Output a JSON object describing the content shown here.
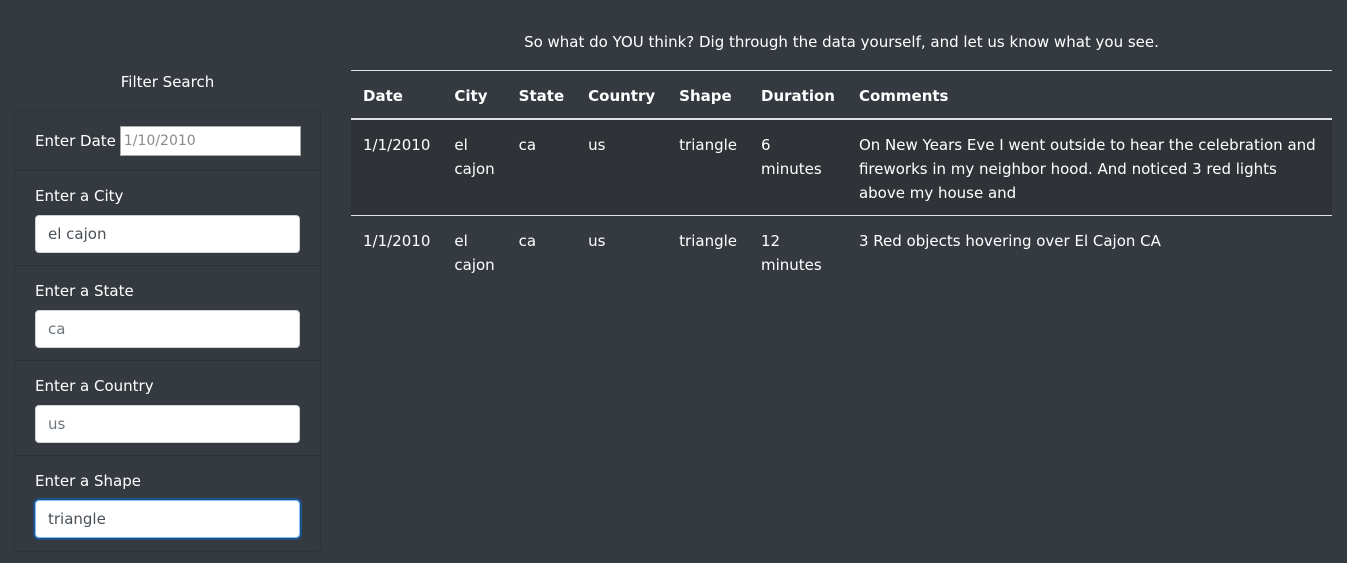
{
  "sidebar": {
    "title": "Filter Search",
    "date": {
      "label": "Enter Date",
      "placeholder": "1/10/2010",
      "value": ""
    },
    "city": {
      "label": "Enter a City",
      "placeholder": "",
      "value": "el cajon"
    },
    "state": {
      "label": "Enter a State",
      "placeholder": "ca",
      "value": ""
    },
    "country": {
      "label": "Enter a Country",
      "placeholder": "us",
      "value": ""
    },
    "shape": {
      "label": "Enter a Shape",
      "placeholder": "",
      "value": "triangle"
    }
  },
  "main": {
    "tagline": "So what do YOU think? Dig through the data yourself, and let us know what you see.",
    "table": {
      "headers": [
        "Date",
        "City",
        "State",
        "Country",
        "Shape",
        "Duration",
        "Comments"
      ],
      "rows": [
        [
          "1/1/2010",
          "el cajon",
          "ca",
          "us",
          "triangle",
          "6 minutes",
          "On New Years Eve I went outside to hear the celebration and fireworks in my neighbor hood. And noticed 3 red lights above my house and"
        ],
        [
          "1/1/2010",
          "el cajon",
          "ca",
          "us",
          "triangle",
          "12 minutes",
          "3 Red objects hovering over El Cajon CA"
        ]
      ]
    }
  },
  "colors": {
    "background": "#343a40",
    "text": "#ffffff",
    "focus_ring": "#80bdff"
  }
}
